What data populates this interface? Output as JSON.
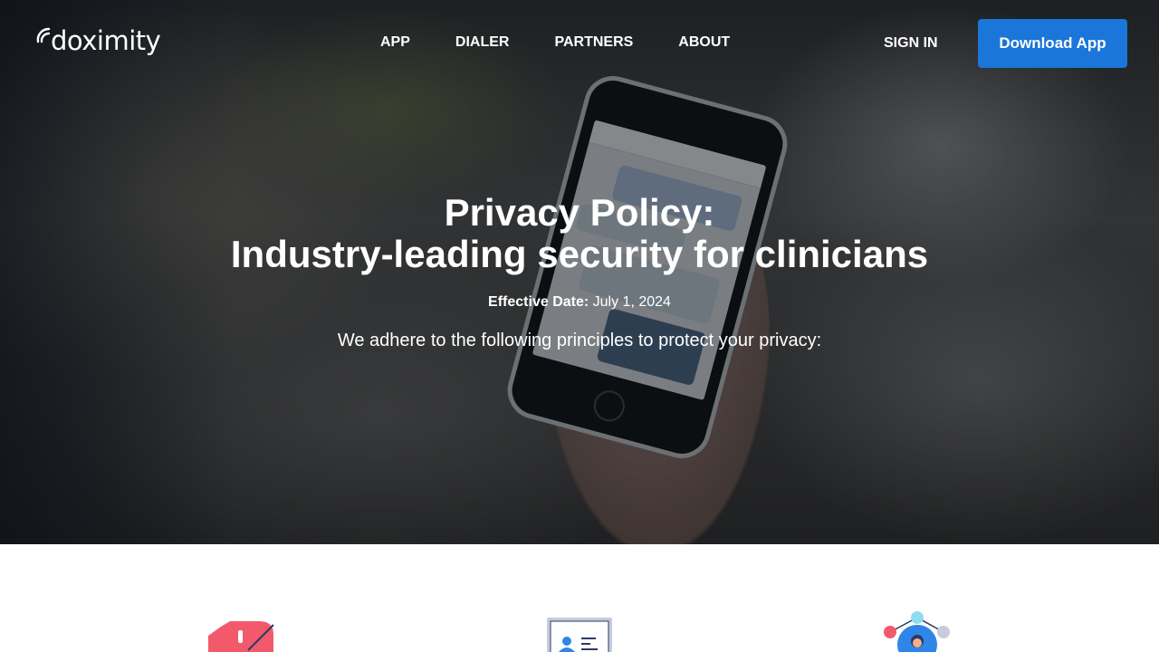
{
  "nav": {
    "logo_text": "doximity",
    "links": [
      {
        "label": "APP"
      },
      {
        "label": "DIALER"
      },
      {
        "label": "PARTNERS"
      },
      {
        "label": "ABOUT"
      }
    ],
    "sign_in": "SIGN IN",
    "download_button": "Download App"
  },
  "hero": {
    "title_line_1": "Privacy Policy:",
    "title_line_2": "Industry-leading security for clinicians",
    "effective_label": "Effective Date:",
    "effective_value": "July 1, 2024",
    "principles_intro": "We adhere to the following principles to protect your privacy:"
  },
  "icons": [
    {
      "name": "no-selling-data-icon"
    },
    {
      "name": "id-card-icon"
    },
    {
      "name": "user-network-icon"
    }
  ],
  "colors": {
    "accent": "#1a76d8",
    "icon_red": "#f25a6b",
    "icon_navy": "#2b3a67",
    "icon_blue": "#2f86e6"
  }
}
